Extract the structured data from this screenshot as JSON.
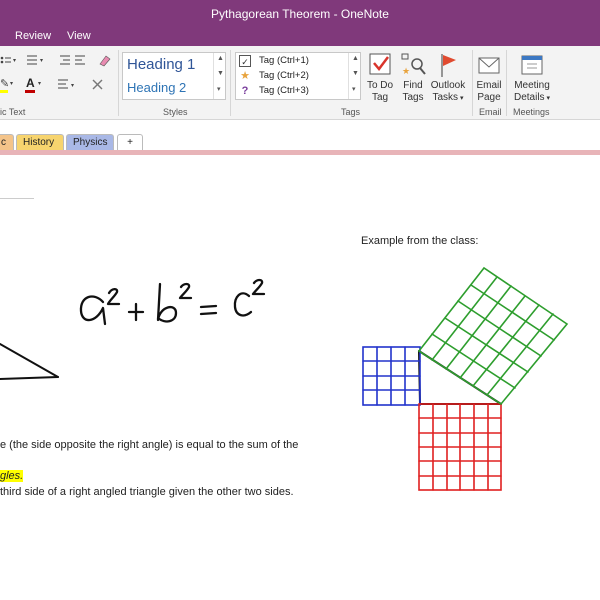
{
  "window": {
    "title": "Pythagorean Theorem - OneNote"
  },
  "menu": {
    "items": [
      "Review",
      "View"
    ]
  },
  "ribbon": {
    "basic_text_label": "ic Text",
    "styles": {
      "heading1": "Heading 1",
      "heading2": "Heading 2",
      "label": "Styles"
    },
    "tags": {
      "items": [
        {
          "icon": "checkbox-icon",
          "label": "Tag (Ctrl+1)"
        },
        {
          "icon": "star-icon",
          "label": "Tag (Ctrl+2)"
        },
        {
          "icon": "question-icon",
          "label": "Tag (Ctrl+3)"
        }
      ],
      "label": "Tags",
      "todo": [
        "To Do",
        "Tag"
      ],
      "find": [
        "Find",
        "Tags"
      ],
      "outlook": [
        "Outlook",
        "Tasks"
      ]
    },
    "email": {
      "lines": [
        "Email",
        "Page"
      ],
      "label": "Email"
    },
    "meetings": {
      "lines": [
        "Meeting",
        "Details"
      ],
      "label": "Meetings"
    }
  },
  "section_tabs": [
    {
      "label": "c",
      "color": "#F4C48A"
    },
    {
      "label": "History",
      "color": "#F7D46E"
    },
    {
      "label": "Physics",
      "color": "#A9B8E6"
    },
    {
      "label": "+",
      "color": "#FFFFFF"
    }
  ],
  "page": {
    "example_label": "Example from the class:",
    "body_line1": "e (the side opposite the right angle) is equal to the sum of the",
    "body_highlight": "gles.",
    "body_line3": "third side of a right angled triangle given the other two sides."
  },
  "ink": {
    "equation": "a² + b² = c²",
    "colors": {
      "small_square": "#2233CC",
      "large_square": "#2E9E2E",
      "bottom_square": "#E02020",
      "triangle": "#111111"
    }
  }
}
